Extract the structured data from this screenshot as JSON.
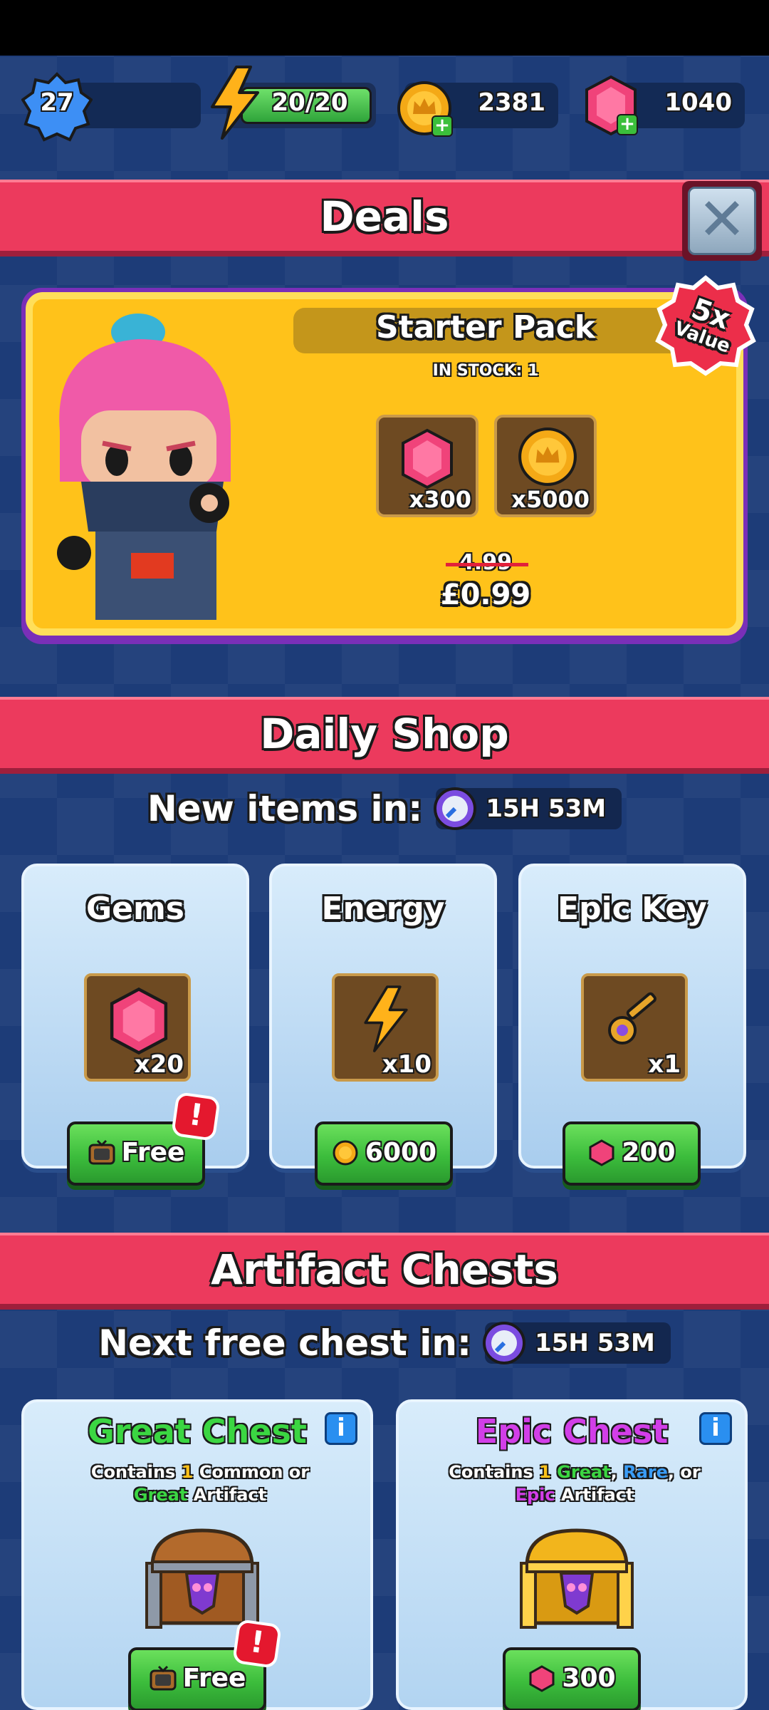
{
  "resources": {
    "level": "27",
    "energy": "20/20",
    "coins": "2381",
    "gems": "1040"
  },
  "deals": {
    "title": "Deals",
    "pack_title": "Starter Pack",
    "stock": "IN STOCK: 1",
    "value_badge_big": "5x",
    "value_badge_small": "Value",
    "items": [
      {
        "icon": "gem-icon",
        "qty": "x300"
      },
      {
        "icon": "coin-icon",
        "qty": "x5000"
      }
    ],
    "old_price": "4.99",
    "price": "£0.99"
  },
  "daily_shop": {
    "title": "Daily Shop",
    "timer_label": "New items in:",
    "timer": "15H 53M",
    "cards": [
      {
        "title": "Gems",
        "icon": "gem-icon",
        "qty": "x20",
        "button": "Free",
        "button_icon": "tv-ad-icon"
      },
      {
        "title": "Energy",
        "icon": "energy-bolt-icon",
        "qty": "x10",
        "button": "6000",
        "button_icon": "coin-icon"
      },
      {
        "title": "Epic Key",
        "icon": "key-icon",
        "qty": "x1",
        "button": "200",
        "button_icon": "gem-icon"
      }
    ]
  },
  "chests": {
    "title": "Artifact Chests",
    "timer_label": "Next free chest in:",
    "timer": "15H 53M",
    "great": {
      "title": "Great Chest",
      "desc_1": "Contains ",
      "desc_num": "1",
      "desc_2": " Common or",
      "desc_great": "Great",
      "desc_3": " Artifact",
      "button": "Free"
    },
    "epic": {
      "title": "Epic Chest",
      "desc_1": "Contains ",
      "desc_num": "1",
      "desc_great": "Great",
      "desc_comma": ", ",
      "desc_rare": "Rare",
      "desc_or": ", or",
      "desc_epic": "Epic",
      "desc_3": " Artifact",
      "button": "300"
    }
  },
  "colors": {
    "header_red": "#ec3a5d",
    "button_green": "#3cbd3c",
    "pack_yellow": "#ffc21a",
    "background_navy": "#1d3c78"
  }
}
